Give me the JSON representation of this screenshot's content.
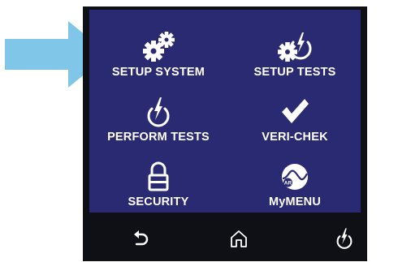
{
  "pointer_arrow": {
    "color": "#7fc6e8"
  },
  "colors": {
    "menu_bg": "#2a2a72",
    "frame_bg": "#0f0f16",
    "text": "#ffffff"
  },
  "menu": {
    "items": [
      {
        "label": "SETUP SYSTEM",
        "icon": "gears-icon"
      },
      {
        "label": "SETUP TESTS",
        "icon": "gear-power-icon"
      },
      {
        "label": "PERFORM TESTS",
        "icon": "power-bolt-icon"
      },
      {
        "label": "VERI-CHEK",
        "icon": "checkmark-icon"
      },
      {
        "label": "SECURITY",
        "icon": "padlock-icon"
      },
      {
        "label": "MyMENU",
        "icon": "ar-logo-icon"
      }
    ]
  },
  "navbar": {
    "buttons": [
      {
        "icon": "back-arrow-icon"
      },
      {
        "icon": "home-icon"
      },
      {
        "icon": "power-bolt-icon"
      }
    ]
  }
}
